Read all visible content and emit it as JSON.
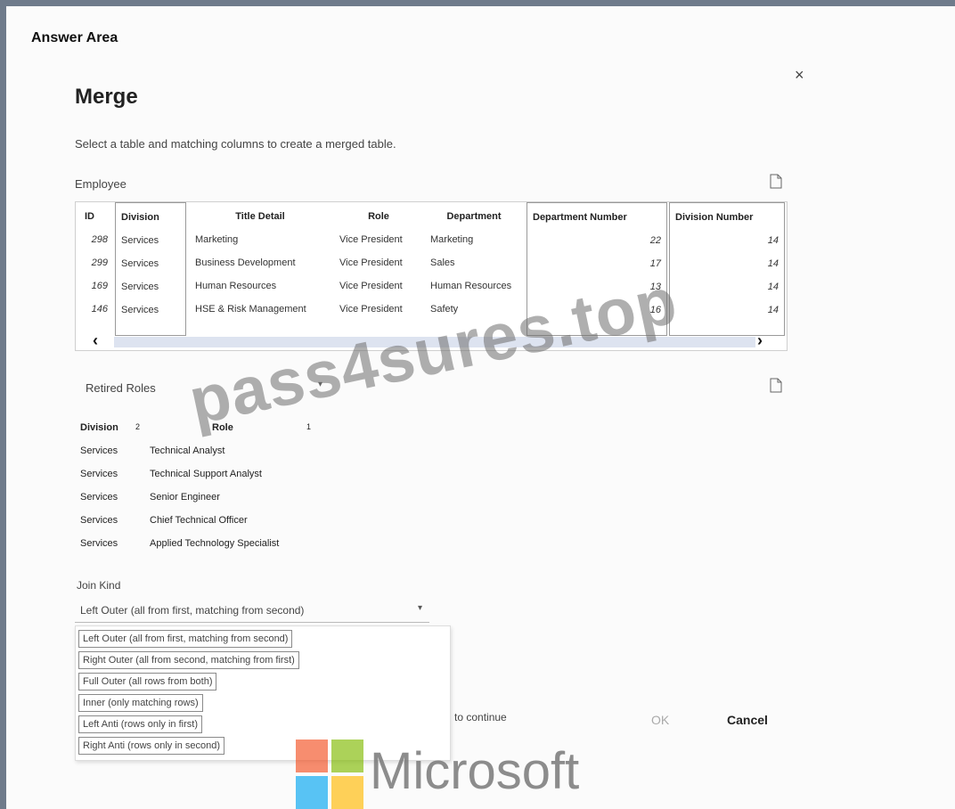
{
  "answer_area_label": "Answer Area",
  "dialog": {
    "title": "Merge",
    "subtitle": "Select a table and matching columns to create a merged table.",
    "close_glyph": "×"
  },
  "first_table": {
    "name": "Employee",
    "columns": [
      "ID",
      "Division",
      "Title Detail",
      "Role",
      "Department",
      "Department Number",
      "Division Number"
    ],
    "selected_columns": [
      "Division",
      "Department Number",
      "Division Number"
    ],
    "rows": [
      [
        "298",
        "Services",
        "Marketing",
        "Vice President",
        "Marketing",
        "22",
        "14"
      ],
      [
        "299",
        "Services",
        "Business Development",
        "Vice President",
        "Sales",
        "17",
        "14"
      ],
      [
        "169",
        "Services",
        "Human Resources",
        "Vice President",
        "Human Resources",
        "13",
        "14"
      ],
      [
        "146",
        "Services",
        "HSE & Risk Management",
        "Vice President",
        "Safety",
        "16",
        "14"
      ]
    ],
    "scroll_left": "‹",
    "scroll_right": "›"
  },
  "second_table": {
    "name": "Retired Roles",
    "columns": [
      {
        "name": "Division",
        "order": "2"
      },
      {
        "name": "Role",
        "order": "1"
      }
    ],
    "rows": [
      [
        "Services",
        "Technical Analyst"
      ],
      [
        "Services",
        "Technical Support Analyst"
      ],
      [
        "Services",
        "Senior Engineer"
      ],
      [
        "Services",
        "Chief Technical Officer"
      ],
      [
        "Services",
        "Applied Technology Specialist"
      ]
    ]
  },
  "join_kind": {
    "label": "Join Kind",
    "selected": "Left Outer (all from first, matching from second)",
    "options": [
      "Left Outer (all from first, matching from second)",
      "Right Outer (all from second, matching from first)",
      "Full Outer (all rows from both)",
      "Inner (only matching rows)",
      "Left Anti (rows only in first)",
      "Right Anti (rows only in second)"
    ]
  },
  "footer": {
    "continue_text": "to continue",
    "ok_label": "OK",
    "cancel_label": "Cancel"
  },
  "watermark": "pass4sures.top",
  "brand": {
    "name": "Microsoft",
    "colors": [
      "#f25022",
      "#7fba00",
      "#00a4ef",
      "#ffb900"
    ]
  },
  "colors": {
    "frame_border": "#6f7b8b",
    "scroll_thumb": "#dde3f0"
  }
}
